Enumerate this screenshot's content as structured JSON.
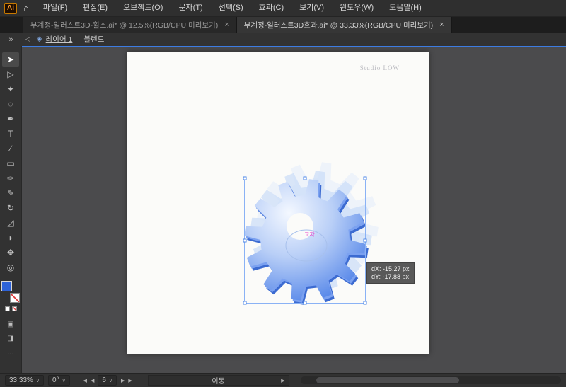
{
  "titlebar": {
    "logo": "Ai",
    "home_icon": "⌂",
    "menus": [
      "파일(F)",
      "편집(E)",
      "오브젝트(O)",
      "문자(T)",
      "선택(S)",
      "효과(C)",
      "보기(V)",
      "윈도우(W)",
      "도움말(H)"
    ]
  },
  "tabs": [
    {
      "title": "부계정-일러스트3D-휠스.ai* @ 12.5%(RGB/CPU 미리보기)",
      "close": "×",
      "active": false
    },
    {
      "title": "부계정-일러스트3D효과.ai* @ 33.33%(RGB/CPU 미리보기)",
      "close": "×",
      "active": true
    }
  ],
  "controlbar": {
    "expand_icon": "»",
    "back_icon": "◁",
    "layers_icon": "◈",
    "layer_link": "레이어 1",
    "object_label": "블렌드"
  },
  "toolbar": {
    "tools": [
      {
        "name": "selection-tool",
        "glyph": "➤",
        "active": true
      },
      {
        "name": "direct-selection-tool",
        "glyph": "▷"
      },
      {
        "name": "magic-wand-tool",
        "glyph": "✦"
      },
      {
        "name": "lasso-tool",
        "glyph": "◌"
      },
      {
        "name": "pen-tool",
        "glyph": "✒"
      },
      {
        "name": "type-tool",
        "glyph": "T"
      },
      {
        "name": "line-segment-tool",
        "glyph": "∕"
      },
      {
        "name": "rectangle-tool",
        "glyph": "▭"
      },
      {
        "name": "paintbrush-tool",
        "glyph": "✑"
      },
      {
        "name": "pencil-tool",
        "glyph": "✎"
      },
      {
        "name": "rotate-tool",
        "glyph": "↻"
      },
      {
        "name": "scale-tool",
        "glyph": "◿"
      },
      {
        "name": "eyedropper-tool",
        "glyph": "◗"
      },
      {
        "name": "hand-tool",
        "glyph": "✥"
      },
      {
        "name": "zoom-tool",
        "glyph": "◎"
      }
    ],
    "fill_color": "#2e63d8",
    "modes": [
      {
        "name": "draw-normal-mode-icon",
        "glyph": "▣"
      },
      {
        "name": "screen-mode-icon",
        "glyph": "◨"
      },
      {
        "name": "edit-toolbar-icon",
        "glyph": "…"
      }
    ]
  },
  "canvas": {
    "artboard_brand": "Studio LOW",
    "smart_guide_label": "교차",
    "smart_guide_color": "#e83bc6",
    "measure_tooltip": {
      "dx": "dX: -15.27 px",
      "dy": "dY: -17.88 px"
    }
  },
  "gear": {
    "teeth": 12,
    "side_color": "#3c6bd1",
    "mid_color": "#7ba1f0",
    "ghost1_color": "#c9dbf8",
    "ghost2_color": "#e4edfc",
    "hole_color": "#fbfbf9",
    "ring_color": "#a7c0ec",
    "gradient": [
      "#f4f8ff",
      "#b9cff7",
      "#4f82e8"
    ]
  },
  "statusbar": {
    "zoom": "33.33%",
    "rotation": "0°",
    "chevron": "∨",
    "nav_first": "|◀",
    "nav_prev": "◀",
    "artboard_number": "6",
    "nav_next": "▶",
    "nav_last": "▶|",
    "status": "이동",
    "popup_arrow": "▶"
  }
}
